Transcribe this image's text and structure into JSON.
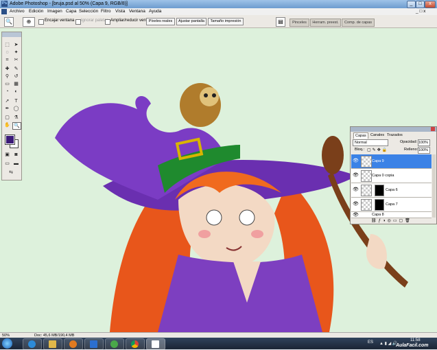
{
  "window": {
    "app_icon": "Ps",
    "title": "Adobe Photoshop - [bruja.psd al 50% (Capa 9, RGB/8)]",
    "minimize": "_",
    "maximize": "□",
    "close": "x"
  },
  "menu": [
    "Archivo",
    "Edición",
    "Imagen",
    "Capa",
    "Selección",
    "Filtro",
    "Vista",
    "Ventana",
    "Ayuda"
  ],
  "options": {
    "zoom_tool_icon": "magnifier-icon",
    "checkboxes": [
      {
        "label": "Encajar ventana",
        "enabled": true
      },
      {
        "label": "Ignorar paletas",
        "enabled": false
      },
      {
        "label": "Ampliar/reducir vent.",
        "enabled": true
      }
    ],
    "buttons": [
      "Píxeles reales",
      "Ajustar pantalla",
      "Tamaño impresión"
    ],
    "palette_well": [
      "Pinceles",
      "Herram. preest.",
      "Comp. de capas"
    ]
  },
  "toolbox": {
    "foreground_color": "#3c1a78",
    "background_color": "#ffffff"
  },
  "layers_panel": {
    "tabs": [
      "Capas",
      "Canales",
      "Trazados"
    ],
    "blend_mode": "Normal",
    "opacity_label": "Opacidad:",
    "opacity_value": "100%",
    "lock_label": "Bloq.:",
    "fill_label": "Relleno:",
    "fill_value": "100%",
    "layers": [
      {
        "name": "Capa 9",
        "selected": true,
        "mask": false
      },
      {
        "name": "Capa 0 copia",
        "selected": false,
        "mask": false
      },
      {
        "name": "Capa 6",
        "selected": false,
        "mask": true
      },
      {
        "name": "Capa 7",
        "selected": false,
        "mask": true
      },
      {
        "name": "Capa 8",
        "selected": false,
        "mask": false
      }
    ]
  },
  "status": {
    "zoom": "50%",
    "doc_info": "Doc: 45,6 MB/190,4 MB"
  },
  "taskbar": {
    "language": "ES",
    "time": "11:58",
    "watermark": "AulaFacil.com"
  }
}
